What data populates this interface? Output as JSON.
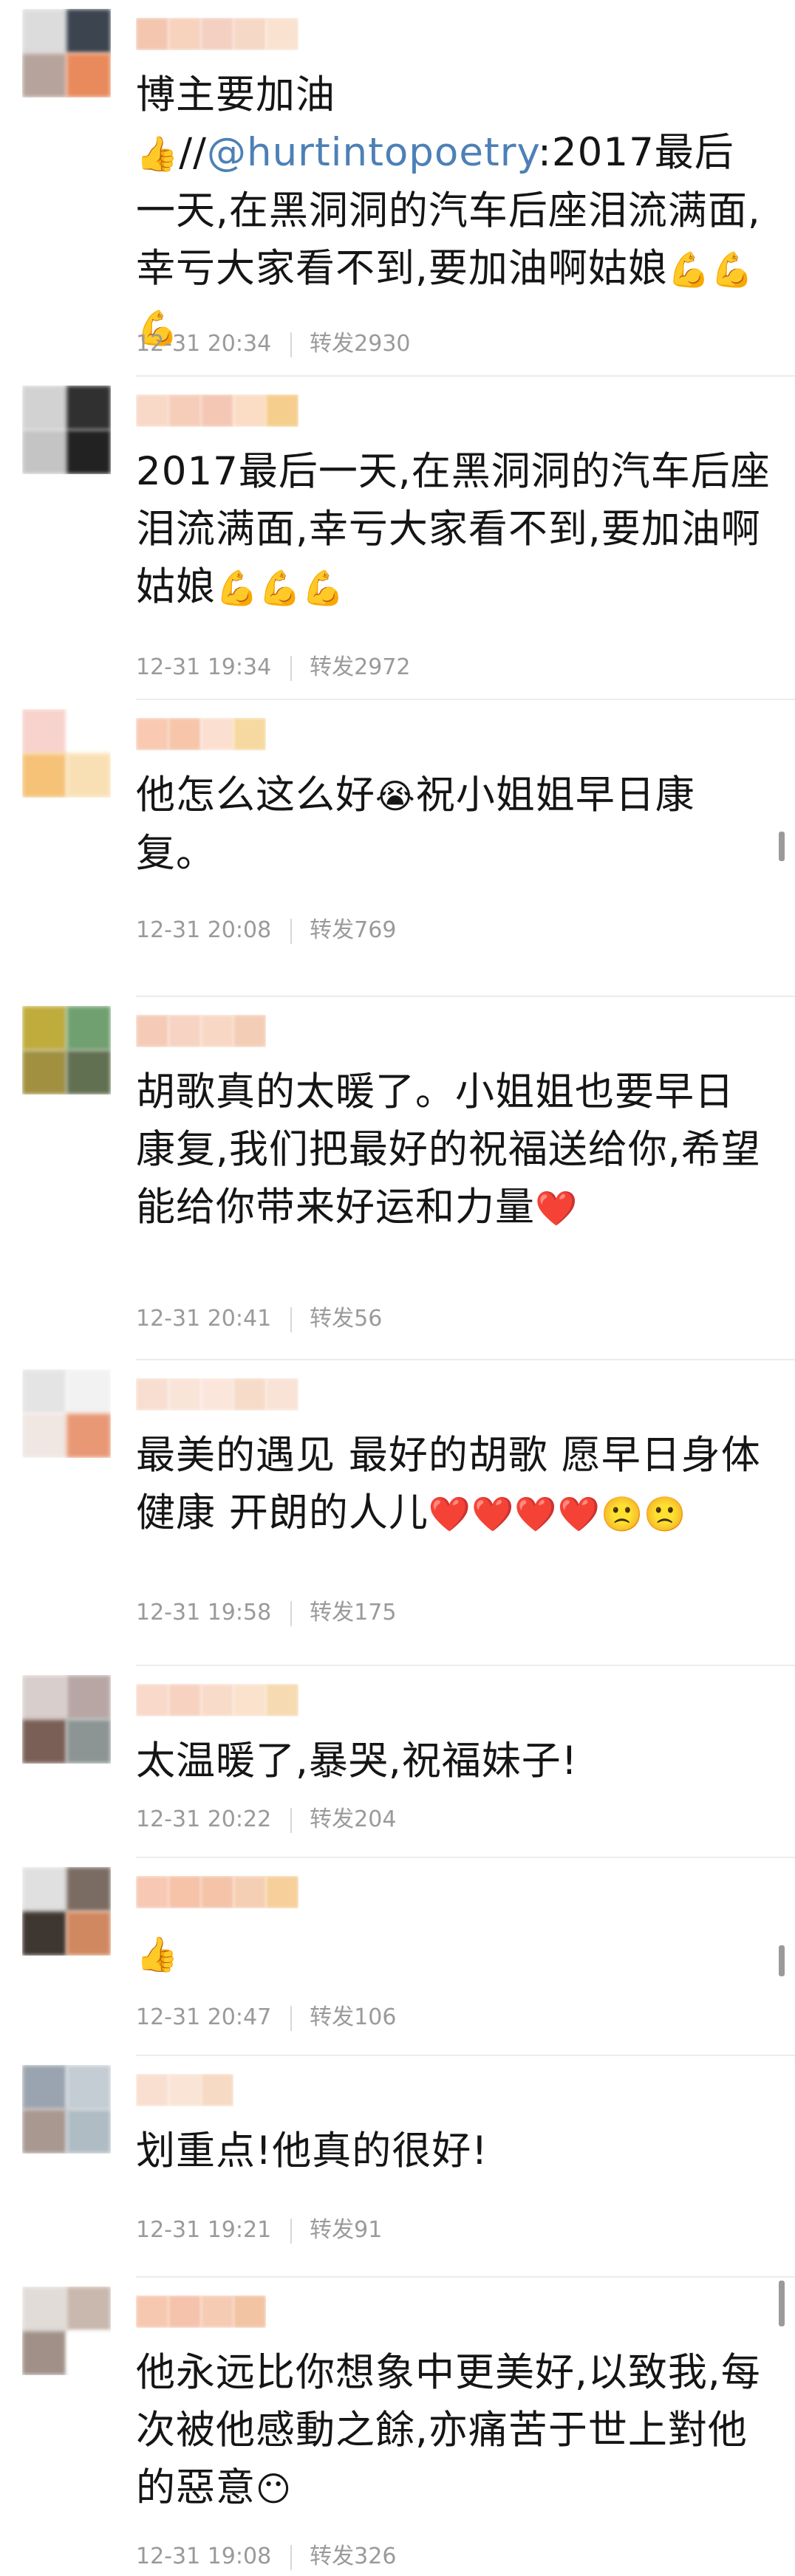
{
  "comments": [
    {
      "text_pre": "博主要加油",
      "emoji_pre": "👍",
      "text_sep": "//",
      "mention": "@hurtintopoetry",
      "text": ":2017最后一天,在黑洞洞的汽车后座泪流满面,幸亏大家看不到,要加油啊姑娘",
      "emoji": "💪💪💪",
      "time": "12-31 20:34",
      "repost": "转发2930",
      "avatar_colors": [
        "#dcdcdc",
        "#3c4450",
        "#b6a49c",
        "#e88a5c"
      ],
      "nick_colors": [
        "#f4c6b0",
        "#f7d2bd",
        "#f3d0c2",
        "#f6d8c6",
        "#f9e2cf"
      ]
    },
    {
      "text": "2017最后一天,在黑洞洞的汽车后座泪流满面,幸亏大家看不到,要加油啊姑娘",
      "emoji": "💪💪💪",
      "time": "12-31 19:34",
      "repost": "转发2972",
      "avatar_colors": [
        "#d2d2d2",
        "#303030",
        "#c4c4c4",
        "#222222"
      ],
      "nick_colors": [
        "#f8d9c7",
        "#f6cdb8",
        "#f4c7b4",
        "#fbdcc5",
        "#f5ce8e"
      ]
    },
    {
      "text": "他怎么这么好",
      "emoji": "😭",
      "text2": "祝小姐姐早日康复。",
      "time": "12-31 20:08",
      "repost": "转发769",
      "avatar_colors": [
        "#f8d2cc",
        "#ffffff",
        "#f5c278",
        "#f9e0b4"
      ],
      "nick_colors": [
        "#f9c9b2",
        "#f6c5aa",
        "#fbe0d2",
        "#f6d9a0"
      ]
    },
    {
      "text": "胡歌真的太暖了。小姐姐也要早日康复,我们把最好的祝福送给你,希望能给你带来好运和力量",
      "emoji": "❤️",
      "time": "12-31 20:41",
      "repost": "转发56",
      "avatar_colors": [
        "#c0ac3c",
        "#70a070",
        "#a09040",
        "#607050"
      ],
      "nick_colors": [
        "#f5cbb8",
        "#f6d3c2",
        "#f8d8c5",
        "#f4cdb6"
      ]
    },
    {
      "text": "最美的遇见 最好的胡歌 愿早日身体健康 开朗的人儿",
      "emoji": "❤️❤️❤️❤️🙁🙁",
      "time": "12-31 19:58",
      "repost": "转发175",
      "avatar_colors": [
        "#e4e4e4",
        "#f2f2f2",
        "#f0e6e2",
        "#e89874"
      ],
      "nick_colors": [
        "#f8ded0",
        "#f9e4d8",
        "#fbe6dc",
        "#f6dcc8",
        "#f8e3d6"
      ]
    },
    {
      "text": "太温暖了,暴哭,祝福妹子!",
      "emoji": "",
      "time": "12-31 20:22",
      "repost": "转发204",
      "avatar_colors": [
        "#d8cfcc",
        "#b8a6a4",
        "#7a5f56",
        "#8c9494"
      ],
      "nick_colors": [
        "#f8d9ca",
        "#f7d2c0",
        "#f9dbc9",
        "#fae2cc",
        "#f6dab2"
      ]
    },
    {
      "text": "",
      "emoji": "👍",
      "time": "12-31 20:47",
      "repost": "转发106",
      "avatar_colors": [
        "#e0e0e0",
        "#7a6c62",
        "#3e3630",
        "#d08860"
      ],
      "nick_colors": [
        "#f7c8b4",
        "#f6c2a8",
        "#f4c3a8",
        "#f5cfb4",
        "#f6cf9a"
      ]
    },
    {
      "text": "划重点!他真的很好!",
      "emoji": "",
      "time": "12-31 19:21",
      "repost": "转发91",
      "avatar_colors": [
        "#9aa4b0",
        "#c4ccd4",
        "#a89890",
        "#b0bcc4"
      ],
      "nick_colors": [
        "#f9dfd0",
        "#fae4d6",
        "#f7dac4"
      ]
    },
    {
      "text": "他永远比你想象中更美好,以致我,每次被他感動之餘,亦痛苦于世上對他的惡意",
      "emoji": "😶",
      "time": "12-31 19:08",
      "repost": "转发326",
      "avatar_colors": [
        "#e2dcd8",
        "#c8b8ae",
        "#a09088",
        "#ffffff"
      ],
      "nick_colors": [
        "#f7c8b0",
        "#f5c2ac",
        "#f6cbb4",
        "#f2c4a4"
      ]
    }
  ]
}
